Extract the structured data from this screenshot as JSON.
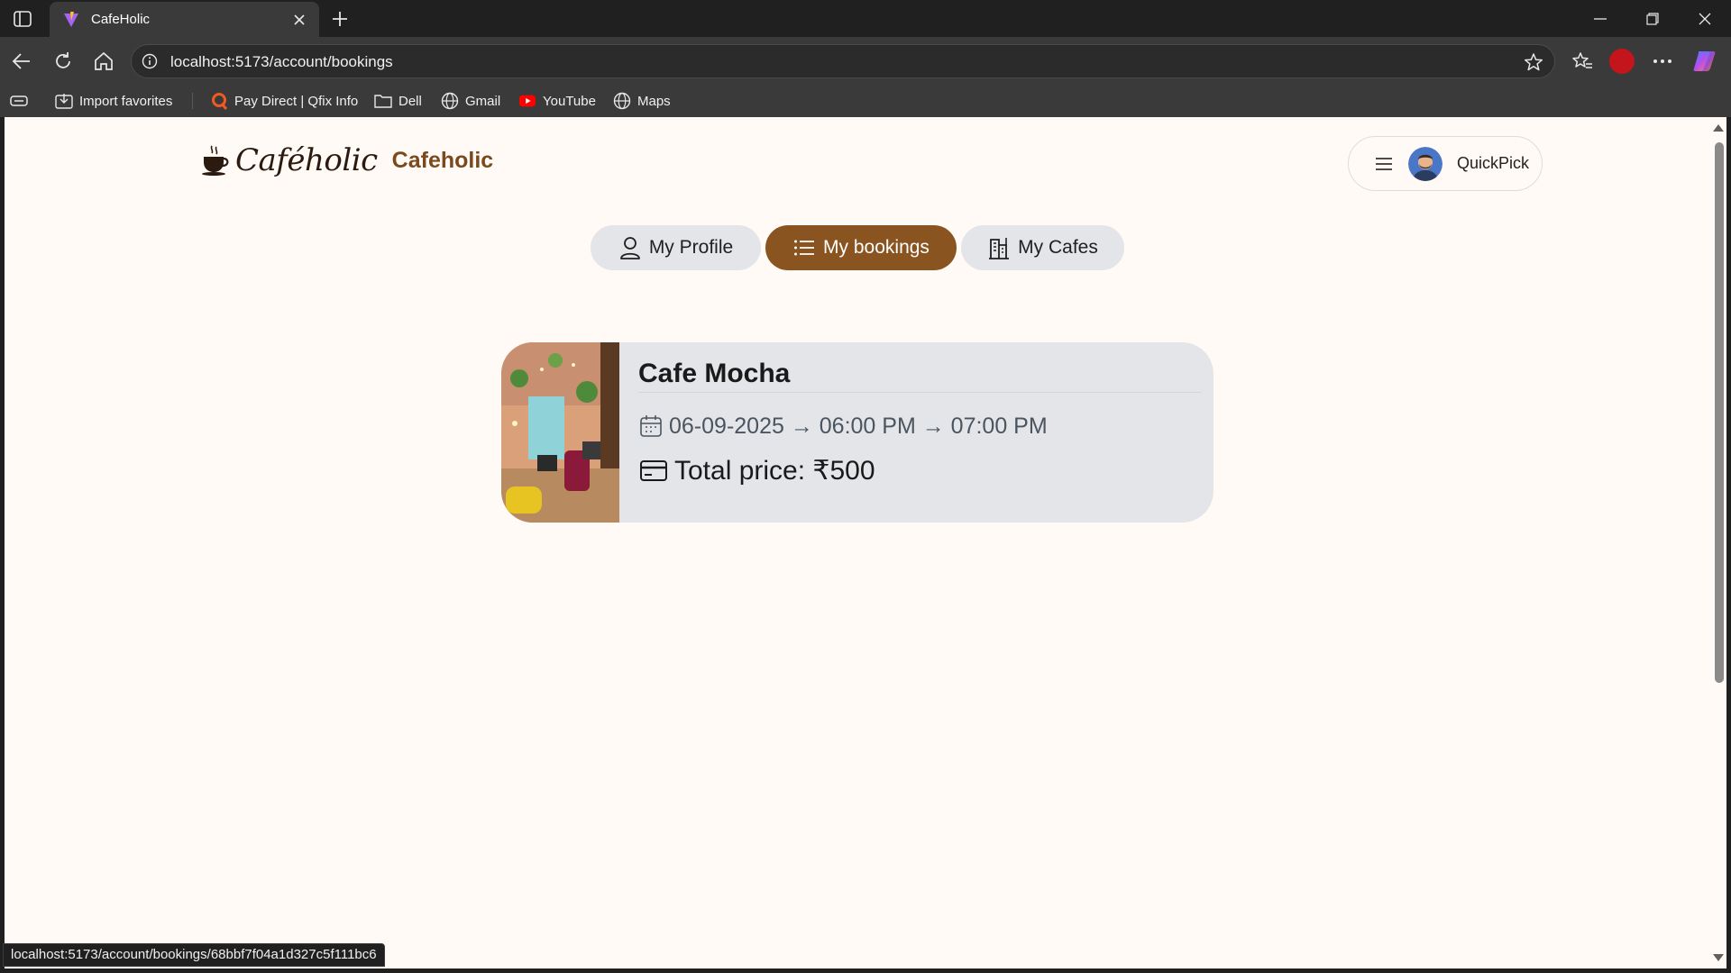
{
  "browser": {
    "tab_title": "CafeHolic",
    "url": "localhost:5173/account/bookings",
    "bookmarks": [
      {
        "label": "Import favorites",
        "icon": "import-icon"
      },
      {
        "label": "Pay Direct | Qfix Info",
        "icon": "qfix-icon"
      },
      {
        "label": "Dell",
        "icon": "folder-icon"
      },
      {
        "label": "Gmail",
        "icon": "globe-icon"
      },
      {
        "label": "YouTube",
        "icon": "youtube-icon"
      },
      {
        "label": "Maps",
        "icon": "globe-icon"
      }
    ],
    "status_url": "localhost:5173/account/bookings/68bbf7f04a1d327c5f111bc6"
  },
  "header": {
    "logo_script": "Caféholic",
    "brand": "Cafeholic",
    "user_name": "QuickPick"
  },
  "nav": {
    "tabs": [
      {
        "label": "My Profile",
        "icon": "user-icon",
        "active": false
      },
      {
        "label": "My bookings",
        "icon": "list-icon",
        "active": true
      },
      {
        "label": "My Cafes",
        "icon": "building-icon",
        "active": false
      }
    ]
  },
  "bookings": [
    {
      "cafe_name": "Cafe Mocha",
      "schedule": "06-09-2025 → 06:00 PM → 07:00 PM",
      "price_text": "Total price: ₹500"
    }
  ],
  "colors": {
    "accent": "#8a5421",
    "page_bg": "#fffaf5",
    "card_bg": "#e4e5e9",
    "brand_text": "#7a4a1f"
  }
}
